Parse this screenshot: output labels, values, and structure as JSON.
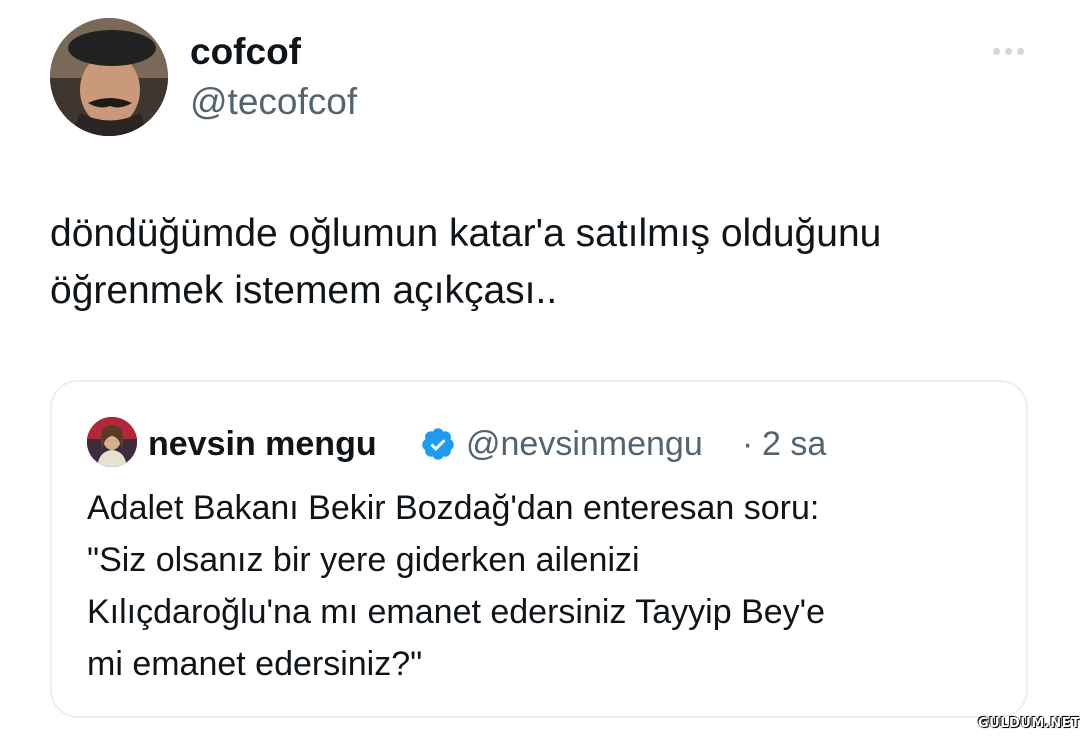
{
  "author": {
    "display_name": "cofcof",
    "handle": "@tecofcof"
  },
  "more_icon": "more-horizontal-icon",
  "tweet": {
    "text_line1": "döndüğümde oğlumun katar'a satılmış olduğunu",
    "text_line2": "öğrenmek istemem açıkçası.."
  },
  "quoted_tweet": {
    "display_name": "nevsin mengu",
    "verified_icon": "verified-badge-icon",
    "verified_color": "#1d9bf0",
    "handle": "@nevsinmengu",
    "separator": "·",
    "time": "2 sa",
    "text_line1": "Adalet Bakanı Bekir Bozdağ'dan enteresan soru:",
    "text_line2": "\"Siz olsanız bir yere giderken ailenizi",
    "text_line3": "Kılıçdaroğlu'na mı emanet edersiniz Tayyip Bey'e",
    "text_line4": "mi emanet edersiniz?\""
  },
  "watermark": "GULDUM.NET"
}
